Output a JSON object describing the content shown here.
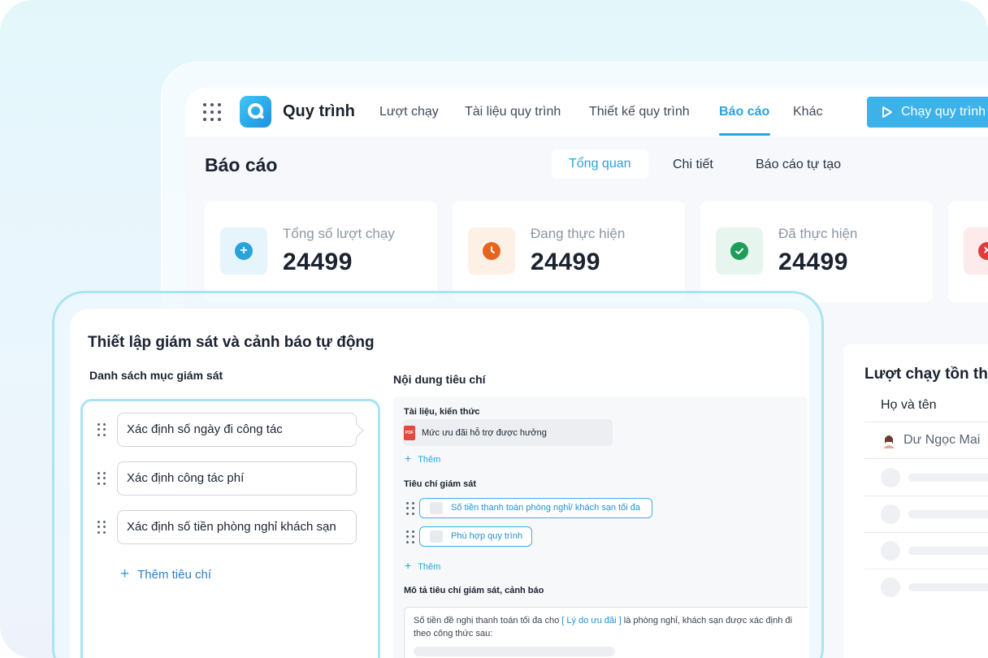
{
  "app": {
    "title": "Quy trình",
    "nav": [
      "Lượt chạy",
      "Tài liệu quy trình",
      "Thiết kế quy trình",
      "Báo cáo",
      "Khác"
    ],
    "active_nav": "Báo cáo",
    "run_button": "Chạy quy trình"
  },
  "report": {
    "title": "Báo cáo",
    "tabs": [
      "Tổng quan",
      "Chi tiết",
      "Báo cáo tự tạo"
    ],
    "active_tab": "Tổng quan",
    "stats": [
      {
        "label": "Tổng số lượt chạy",
        "value": "24499",
        "color": "#2aa3dd",
        "icon": "plus-icon"
      },
      {
        "label": "Đang thực hiện",
        "value": "24499",
        "color": "#e8631e",
        "icon": "clock-icon"
      },
      {
        "label": "Đã thực hiện",
        "value": "24499",
        "color": "#1e9d5a",
        "icon": "check-icon"
      }
    ],
    "table": {
      "title": "Lượt chạy tồn th",
      "column": "Họ và tên",
      "rows": [
        "Dư Ngọc Mai"
      ]
    }
  },
  "modal": {
    "title": "Thiết lập giám sát và cảnh báo tự động",
    "list_label": "Danh sách mục giám sát",
    "items": [
      "Xác định số ngày đi công tác",
      "Xác định công tác phí",
      "Xác định số tiền phòng nghỉ khách sạn"
    ],
    "add_criterion": "Thêm tiêu chí",
    "content_label": "Nội dung tiêu chí",
    "docs_label": "Tài liệu, kiến thức",
    "doc_item": "Mức ưu đãi hỗ trợ được hưởng",
    "add_label": "Thêm",
    "criteria_label": "Tiêu chí giám sát",
    "criteria": [
      "Số tiền thanh toán phòng nghỉ/ khách sạn tối đa",
      "Phù hợp quy trình"
    ],
    "desc_label": "Mô tả tiêu chí giám sát, cảnh báo",
    "desc_before": "Số tiền đề nghị thanh toán tối đa cho ",
    "desc_highlight": "[ Lý do ưu đãi ]",
    "desc_after": " là phòng nghỉ, khách sạn được xác định đi theo công thức sau:"
  }
}
